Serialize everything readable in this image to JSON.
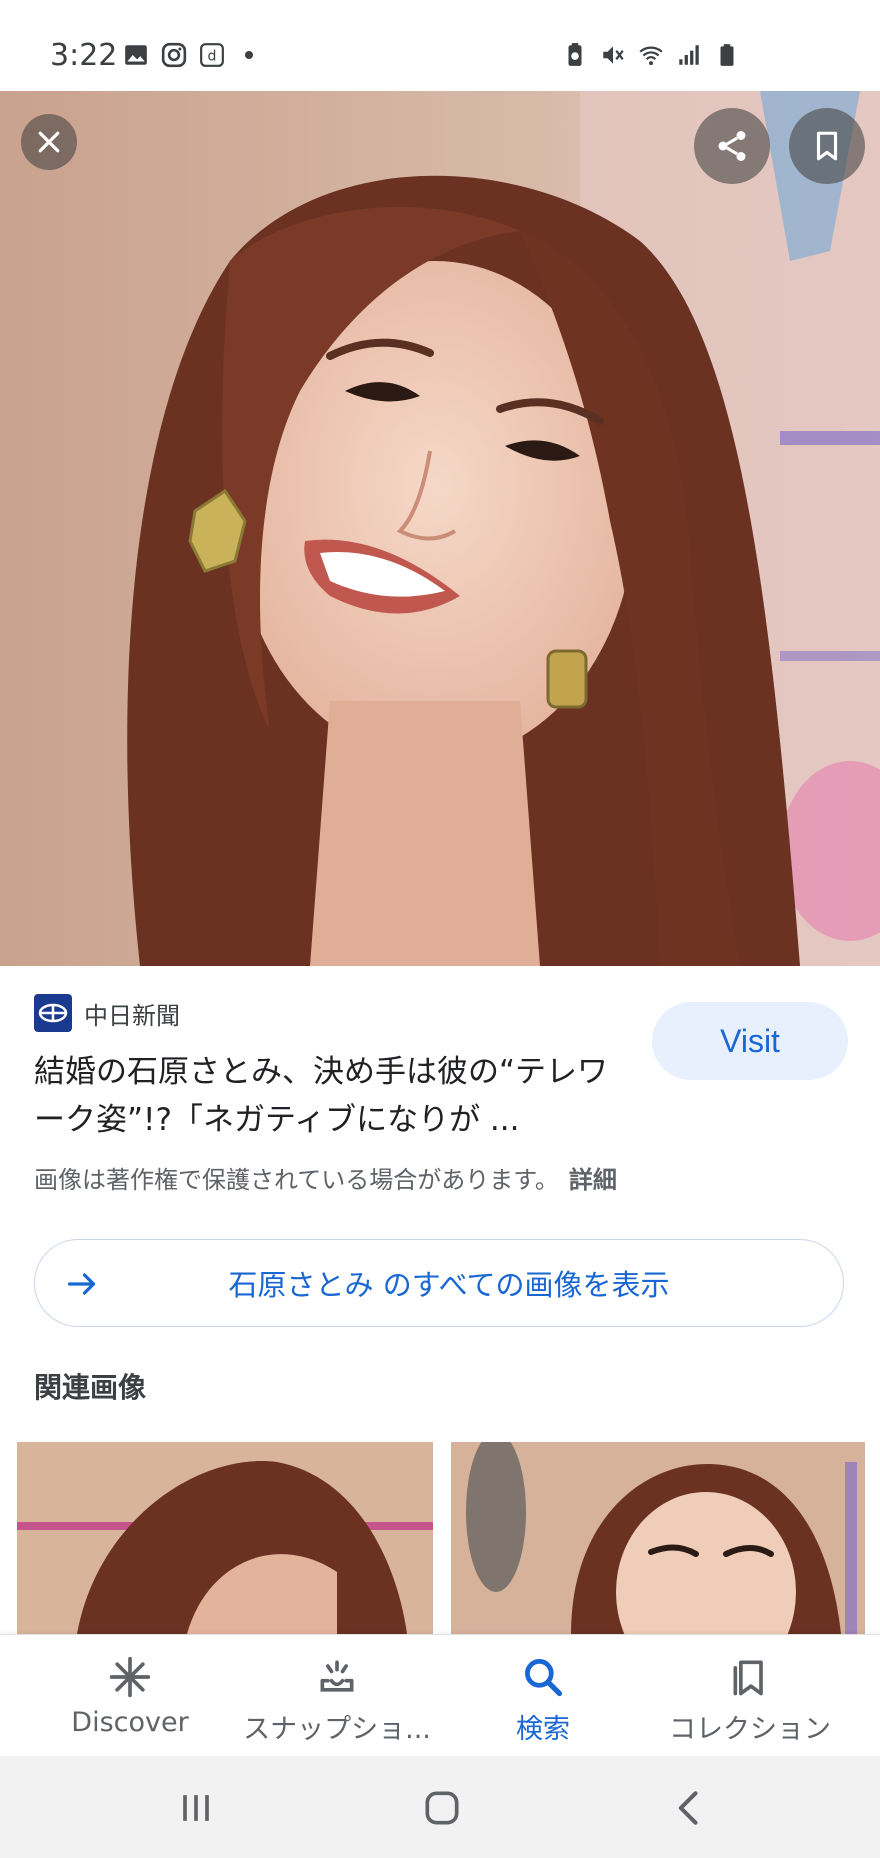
{
  "status_bar": {
    "time": "3:22",
    "left_icons": [
      "gallery-icon",
      "instagram-icon",
      "d-app-icon",
      "notification-dot"
    ],
    "right_icons": [
      "battery-saver-icon",
      "mute-icon",
      "wifi-icon",
      "signal-icon",
      "battery-icon"
    ]
  },
  "hero": {
    "close_icon": "close-icon",
    "share_icon": "share-icon",
    "save_icon": "bookmark-icon"
  },
  "result": {
    "source_name": "中日新聞",
    "title": "結婚の石原さとみ、決め手は彼の“テレワーク姿”!?「ネガティブになりが ...",
    "visit_label": "Visit",
    "copyright_notice": "画像は著作権で保護されている場合があります。",
    "detail_link": "詳細"
  },
  "all_images": {
    "label": "石原さとみ のすべての画像を表示"
  },
  "related": {
    "heading": "関連画像"
  },
  "bottom_nav": {
    "items": [
      {
        "label": "Discover",
        "icon": "asterisk-icon"
      },
      {
        "label": "スナップショ...",
        "icon": "snapshot-icon"
      },
      {
        "label": "検索",
        "icon": "search-icon",
        "active": true
      },
      {
        "label": "コレクション",
        "icon": "collections-icon"
      }
    ]
  },
  "colors": {
    "accent": "#1967d2",
    "visit_bg": "#e8f0fe",
    "text": "#202124",
    "muted": "#5f6368"
  }
}
